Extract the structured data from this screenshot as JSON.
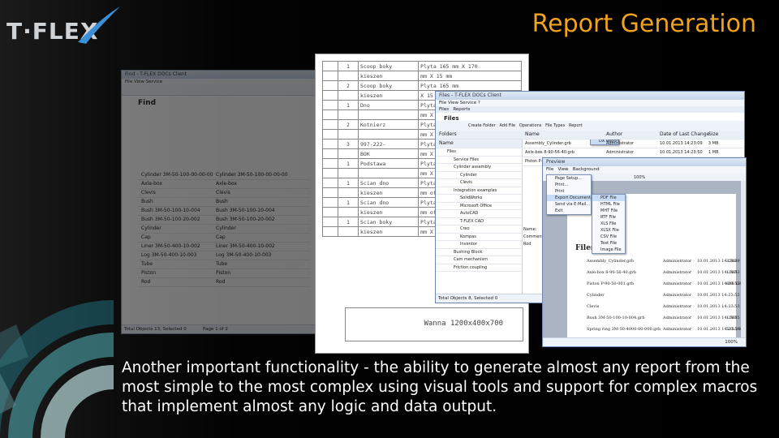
{
  "slide": {
    "logo": "T·FLEX",
    "title": "Report Generation",
    "caption": "Another important  functionality - the ability to generate almost any report from the most simple to the most complex using visual tools and support for complex macros that implement almost any logic and data output."
  },
  "back_window": {
    "title": "Find - T-FLEX DOCs Client",
    "menu": "File   View   Service",
    "heading": "Find",
    "rows": [
      "Cylinder 3M-50-100-00-00-00",
      "Axle-box",
      "Clevis",
      "Bush",
      "Bush 3M-50-100-10-004",
      "Bush 3M-50-100-20-002",
      "Cylinder",
      "Cap",
      "Liner 3M-50-400-10-002",
      "Log 3M-50-400-10-003",
      "Tube",
      "Piston",
      "Rod"
    ],
    "status": "Total Objects 13, Selected 0",
    "page": "Page 1 of 2"
  },
  "sheet": {
    "rows": [
      [
        "1",
        "Scoop boky",
        "Plyta 165 mm X 170"
      ],
      [
        "",
        "kieszen",
        "mm X 15 mm"
      ],
      [
        "2",
        "Scoop boky",
        "Plyta 165 mm"
      ],
      [
        "",
        "kieszen",
        "X 15 mm"
      ],
      [
        "1",
        "Dno",
        "Plyta 1200"
      ],
      [
        "",
        "",
        "mm X 20 mm"
      ],
      [
        "2",
        "Kotnierz",
        "Plyta 1200"
      ],
      [
        "",
        "",
        "mm X 20 mm"
      ],
      [
        "3",
        "997-222-",
        "Plyta 1242"
      ],
      [
        "",
        "BOK",
        "mm X 20 mm"
      ],
      [
        "1",
        "Podstawa",
        "Plyta 1300"
      ],
      [
        "",
        "",
        "mm X 20 mm"
      ],
      [
        "1",
        "Scian dno",
        "Plyta 134mm"
      ],
      [
        "",
        "kieszen",
        "mm otw. Fi"
      ],
      [
        "1",
        "Scian dno",
        "Plyta 136mm"
      ],
      [
        "",
        "kieszen",
        "mm otw. Fi"
      ],
      [
        "1",
        "Scian boky",
        "Plyta 140 mm"
      ],
      [
        "",
        "kieszen",
        "mm X 11 mm"
      ]
    ],
    "footer": "Wanna 1200x400x700"
  },
  "files_window": {
    "title": "Files - T-FLEX DOCs Client",
    "menu": "File   View   Service   ?",
    "tabs": [
      "Files",
      "Reports"
    ],
    "heading": "Files",
    "toolbar": [
      "Create Folder",
      "Add File",
      "Operations",
      "File Types",
      "Report"
    ],
    "report_popup": "DX Report",
    "folders_label": "Folders",
    "name_label": "Name",
    "tree": [
      "Files",
      "Service Files",
      "Cylinder assembly",
      "Cylinder",
      "Clevis",
      "Integration examples",
      "SolidWorks",
      "Microsoft Office",
      "AutoCAD",
      "T-FLEX CAD",
      "Creo",
      "Kompas",
      "Inventor",
      "Bushing Block",
      "Cam mechanism",
      "Friction coupling"
    ],
    "columns": [
      "Name",
      "Author",
      "Date of Last Change",
      "Size"
    ],
    "rows": [
      [
        "Assembly_Cylinder.grb",
        "Administrator",
        "10.01.2013 14:23:09",
        "3 MB"
      ],
      [
        "Axle-box 8-90-56-40.grb",
        "Administrator",
        "10.01.2013 14:23:50",
        "1 MB"
      ],
      [
        "Piston P-90-50-001.grb",
        "Administrator",
        "10.01.2013 14:23:52",
        "690 KB"
      ]
    ],
    "file_types": [
      "T-FLEX CAD Drawing",
      "T-FLEX CAD Model",
      "T-FLEX CAD Model"
    ],
    "side_labels": [
      "Name:",
      "Comments:",
      "Rod"
    ],
    "status": "Total Objects 8, Selected 0"
  },
  "preview_window": {
    "title": "Preview",
    "menu": [
      "File",
      "View",
      "Background"
    ],
    "zoom": "100%",
    "file_menu": [
      "Page Setup...",
      "Print...",
      "Print",
      "Export Document...",
      "Send via E-Mail...",
      "Exit"
    ],
    "export_menu": [
      "PDF File",
      "HTML File",
      "MHT File",
      "RTF File",
      "XLS File",
      "XLSX File",
      "CSV File",
      "Text File",
      "Image File"
    ],
    "page_heading": "Files",
    "rows": [
      [
        "Assembly_Cylinder.grb",
        "Administrator",
        "10.01.2013 14:23:09",
        "3 MB"
      ],
      [
        "Axle-box 8-90-56-40.grb",
        "Administrator",
        "10.01.2013 14:23:52",
        "1 MB"
      ],
      [
        "Piston P-90-50-001.grb",
        "Administrator",
        "10.01.2013 14:23:52",
        "690 KB"
      ],
      [
        "Cylinder",
        "Administrator",
        "10.01.2013 14:23:52",
        ""
      ],
      [
        "Clevis",
        "Administrator",
        "10.01.2013 14:23:53",
        ""
      ],
      [
        "Bush 3M-50-100-10-004.grb",
        "Administrator",
        "10.01.2013 14:23:55",
        "1 MB"
      ],
      [
        "Spring ring 3M-50-4000-00-000.grb",
        "Administrator",
        "10.01.2013 14:23:54",
        "535.5 KB"
      ],
      [
        "Bush 3M-50-100-20-002.grb",
        "Administrator",
        "10.01.2013 14:23:55",
        "527.5 KB"
      ],
      [
        "Rod 3M-50-100-00-004.grb",
        "Administrator",
        "10.01.2013 14:23:55",
        "653.5 KB"
      ]
    ],
    "status_zoom": "100%"
  },
  "colors": {
    "title": "#f0a31c",
    "caption": "#ffffff",
    "logo": "#cfd3d6",
    "accent": "#3b8fd6"
  }
}
